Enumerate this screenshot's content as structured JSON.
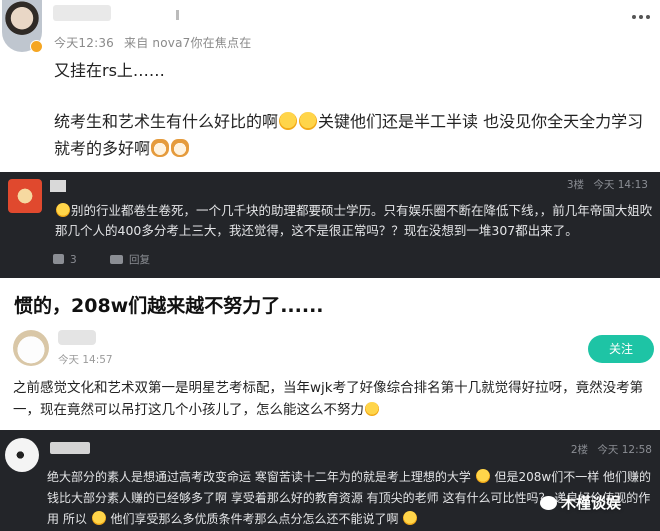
{
  "post": {
    "meta_time": "今天12:36",
    "meta_source": "来自 nova7你在焦点在",
    "first_line": "又挂在rs上……",
    "body_part1": "统考生和艺术生有什么好比的啊",
    "body_part2": "关键他们还是半工半读 也没见你全天全力学习就考的多好啊"
  },
  "reply1": {
    "floor": "3楼",
    "time": "今天 14:13",
    "text": "别的行业都卷生卷死，一个几千块的助理都要硕士学历。只有娱乐圈不断在降低下线，，前几年帝国大姐吹那几个人的400多分考上三大，我还觉得，这不是很正常吗？？现在没想到一堆307都出来了。",
    "likes": "3",
    "reply_label": "回复"
  },
  "headline": "惯的，208w们越来越不努力了......",
  "post2": {
    "time": "今天 14:57",
    "follow_label": "关注",
    "text": "之前感觉文化和艺术双第一是明星艺考标配，当年wjk考了好像综合排名第十几就觉得好拉呀，竟然没考第一，现在竟然可以吊打这几个小孩儿了，怎么能这么不努力"
  },
  "reply2": {
    "floor": "2楼",
    "time": "今天 12:58",
    "text_part1": "绝大部分的素人是想通过高考改变命运 寒窗苦读十二年为的就是考上理想的大学",
    "text_part2": "但是208w们不一样 他们赚的钱比大部分素人赚的已经够多了啊 享受着那么好的教育资源 有顶尖的老师 这有什么可比性吗？",
    "text_part3": "递良好价值观的作用 所以",
    "text_part4": "他们享受那么多优质条件考那么点分怎么还不能说了啊"
  },
  "watermark": "木槿谈娱",
  "colors": {
    "follow_button": "#1ec4a5",
    "dark_bg": "#232529"
  }
}
